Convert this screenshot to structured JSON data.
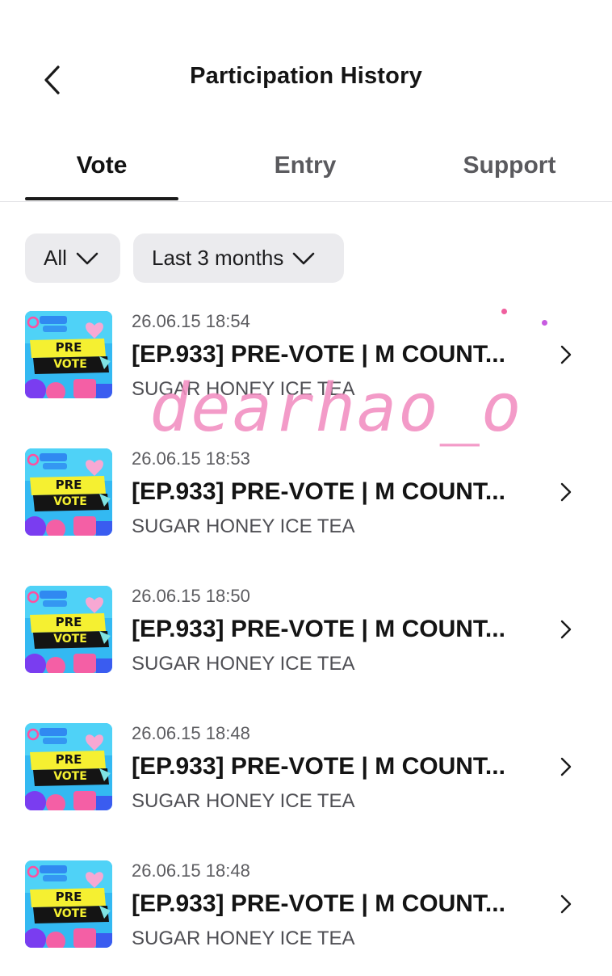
{
  "header": {
    "title": "Participation History",
    "back_icon": "chevron-left-icon"
  },
  "tabs": [
    {
      "label": "Vote",
      "active": true
    },
    {
      "label": "Entry",
      "active": false
    },
    {
      "label": "Support",
      "active": false
    }
  ],
  "filters": {
    "type": {
      "value": "All",
      "icon": "chevron-down-icon"
    },
    "period": {
      "value": "Last 3 months",
      "icon": "chevron-down-icon"
    }
  },
  "items": [
    {
      "date": "26.06.15 18:54",
      "title": "[EP.933] PRE-VOTE | M COUNT...",
      "subtitle": "SUGAR HONEY ICE TEA",
      "thumb_text_top": "PRE",
      "thumb_text_bottom": "VOTE"
    },
    {
      "date": "26.06.15 18:53",
      "title": "[EP.933] PRE-VOTE | M COUNT...",
      "subtitle": "SUGAR HONEY ICE TEA",
      "thumb_text_top": "PRE",
      "thumb_text_bottom": "VOTE"
    },
    {
      "date": "26.06.15 18:50",
      "title": "[EP.933] PRE-VOTE | M COUNT...",
      "subtitle": "SUGAR HONEY ICE TEA",
      "thumb_text_top": "PRE",
      "thumb_text_bottom": "VOTE"
    },
    {
      "date": "26.06.15 18:48",
      "title": "[EP.933] PRE-VOTE | M COUNT...",
      "subtitle": "SUGAR HONEY ICE TEA",
      "thumb_text_top": "PRE",
      "thumb_text_bottom": "VOTE"
    },
    {
      "date": "26.06.15 18:48",
      "title": "[EP.933] PRE-VOTE | M COUNT...",
      "subtitle": "SUGAR HONEY ICE TEA",
      "thumb_text_top": "PRE",
      "thumb_text_bottom": "VOTE"
    }
  ],
  "watermark": {
    "text": "dearhao_o",
    "color": "#f28ec1"
  },
  "colors": {
    "chip_bg": "#ebebee",
    "thumb_bg": "#33b9f2",
    "thumb_banner": "#f5f031",
    "thumb_black": "#141414",
    "thumb_pink": "#f45fa5"
  }
}
